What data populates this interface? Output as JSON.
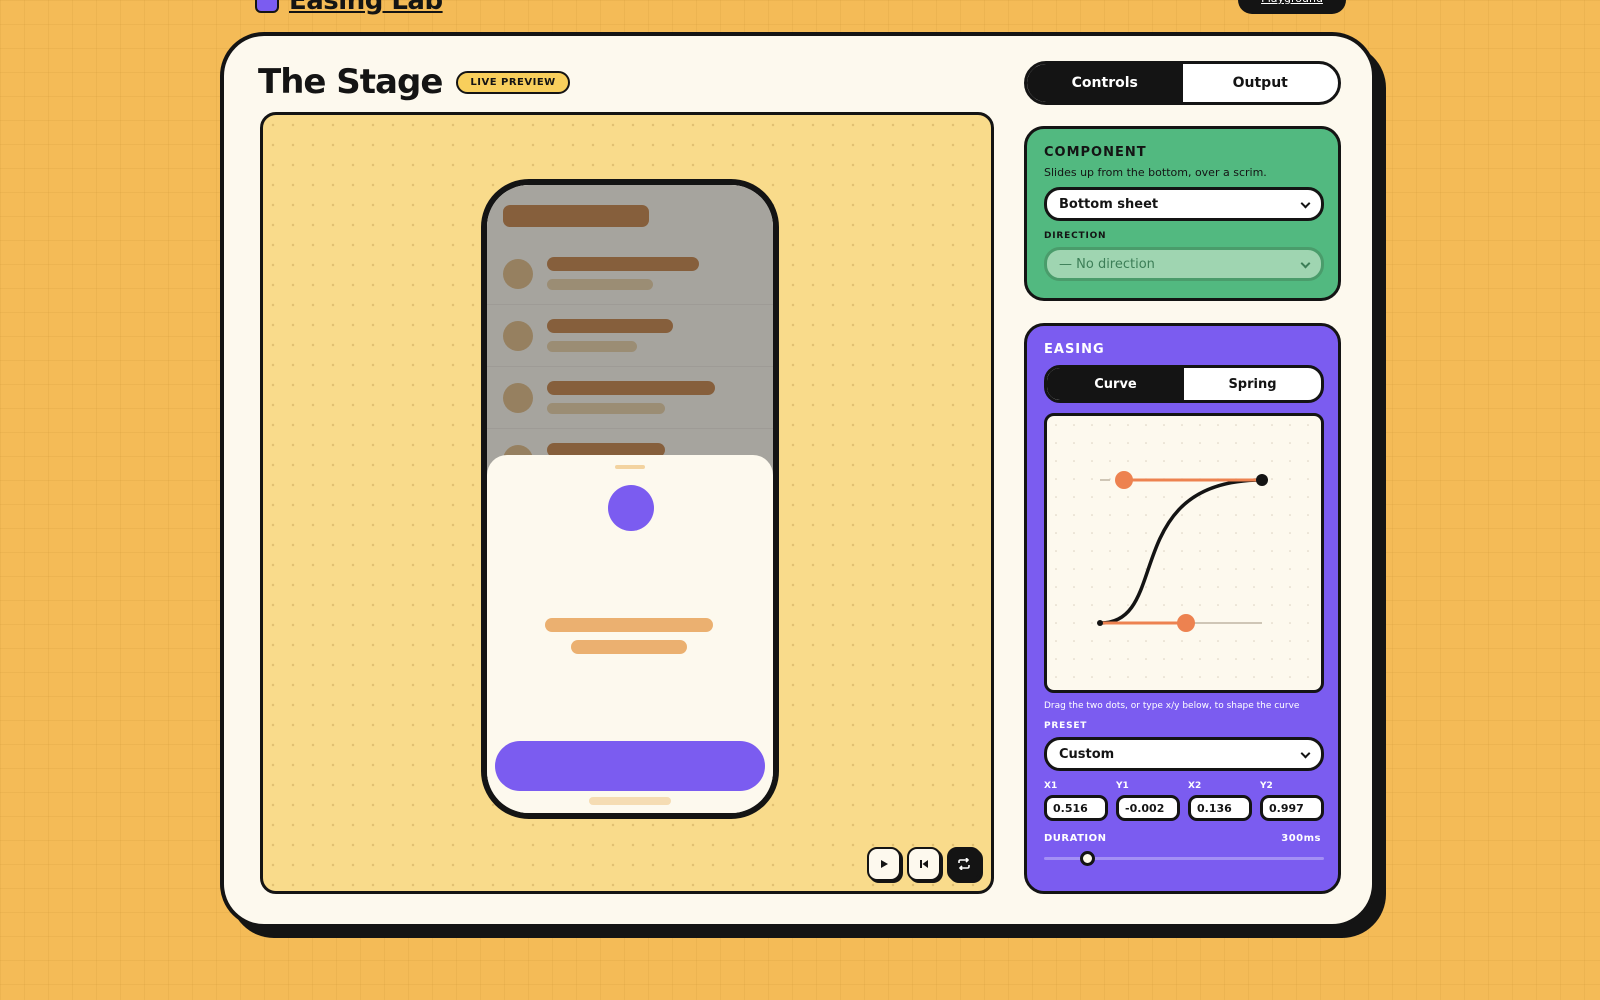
{
  "app": {
    "brand": "Easing Lab",
    "nav_button": "Playground"
  },
  "stage": {
    "title": "The Stage",
    "badge": "LIVE PREVIEW"
  },
  "tabs": [
    {
      "label": "Controls",
      "active": true
    },
    {
      "label": "Output",
      "active": false
    }
  ],
  "component": {
    "heading": "COMPONENT",
    "description": "Slides up from the bottom, over a scrim.",
    "select_value": "Bottom sheet",
    "direction_label": "DIRECTION",
    "direction_value": "— No direction"
  },
  "easing": {
    "heading": "EASING",
    "modes": [
      {
        "label": "Curve",
        "active": true
      },
      {
        "label": "Spring",
        "active": false
      }
    ],
    "hint": "Drag the two dots, or type x/y below, to shape the curve",
    "preset_label": "PRESET",
    "preset_value": "Custom",
    "bezier": [
      {
        "label": "X1",
        "value": "0.516"
      },
      {
        "label": "Y1",
        "value": "-0.002"
      },
      {
        "label": "X2",
        "value": "0.136"
      },
      {
        "label": "Y2",
        "value": "0.997"
      }
    ],
    "duration_label": "DURATION",
    "duration_value": "300ms"
  },
  "colors": {
    "accent": "#7b5cf0",
    "green": "#52b980",
    "handle": "#ed8250",
    "background": "#f4bb57"
  }
}
